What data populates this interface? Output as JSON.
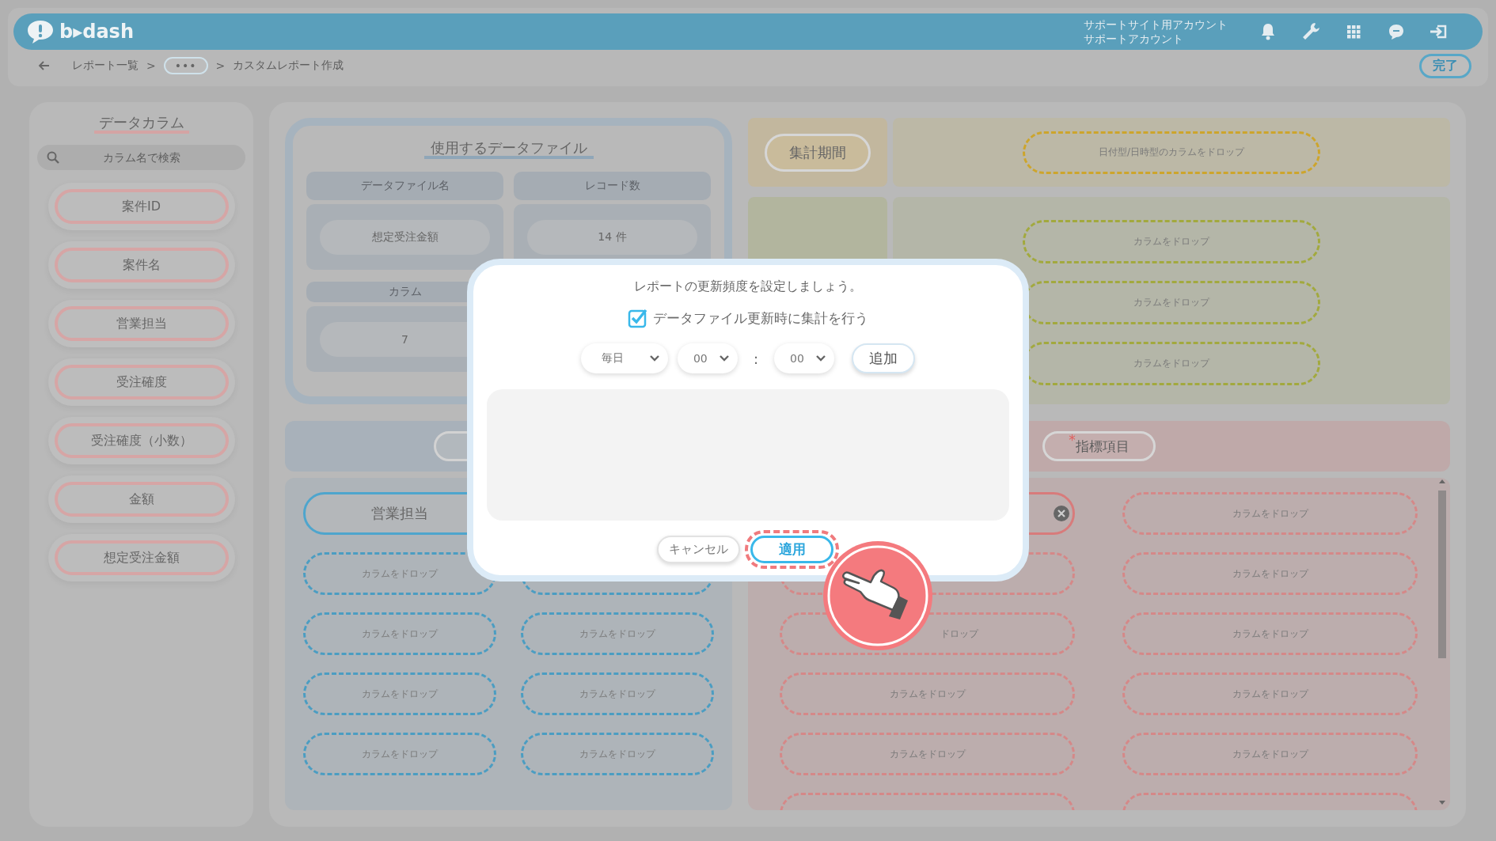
{
  "header": {
    "logo": "b▸dash",
    "account_lines": [
      "サポートサイト用アカウント",
      "サポートアカウント"
    ]
  },
  "breadcrumb": {
    "items": [
      {
        "kind": "link",
        "text": "レポート一覧"
      },
      {
        "kind": "more",
        "text": "•••"
      },
      {
        "kind": "current",
        "text": "カスタムレポート作成"
      }
    ],
    "separator": ">"
  },
  "done_button": "完了",
  "sidebar": {
    "title": "データカラム",
    "search_placeholder": "カラム名で検索",
    "columns": [
      "案件ID",
      "案件名",
      "営業担当",
      "受注確度",
      "受注確度（小数）",
      "金額",
      "想定受注金額"
    ]
  },
  "data_file": {
    "title": "使用するデータファイル",
    "headers": [
      "データファイル名",
      "レコード数"
    ],
    "values": [
      "想定受注金額",
      "14 件"
    ],
    "column_header": "カラム",
    "column_value": "7"
  },
  "period": {
    "label": "集計期間",
    "drop": "日付型/日時型のカラムをドロップ"
  },
  "axis_drops": [
    "カラムをドロップ",
    "カラムをドロップ",
    "カラムをドロップ"
  ],
  "dimensions": {
    "columns": [
      [
        {
          "kind": "filled",
          "text": "営業担当"
        },
        {
          "kind": "drop",
          "text": "カラムをドロップ"
        },
        {
          "kind": "drop",
          "text": "カラムをドロップ"
        },
        {
          "kind": "drop",
          "text": "カラムをドロップ"
        },
        {
          "kind": "drop",
          "text": "カラムをドロップ"
        }
      ],
      [
        {
          "kind": "covered"
        },
        {
          "kind": "drop"
        },
        {
          "kind": "drop",
          "text": "カラムをドロップ"
        },
        {
          "kind": "drop",
          "text": "カラムをドロップ"
        },
        {
          "kind": "drop",
          "text": "カラムをドロップ"
        }
      ]
    ]
  },
  "metrics": {
    "required_mark": "*",
    "label": "指標項目",
    "columns": [
      [
        {
          "kind": "removable"
        },
        {
          "kind": "drop"
        },
        {
          "kind": "drop-tail",
          "text": "ドロップ"
        },
        {
          "kind": "drop",
          "text": "カラムをドロップ"
        },
        {
          "kind": "drop",
          "text": "カラムをドロップ"
        },
        {
          "kind": "drop"
        }
      ],
      [
        {
          "kind": "drop",
          "text": "カラムをドロップ"
        },
        {
          "kind": "drop",
          "text": "カラムをドロップ"
        },
        {
          "kind": "drop",
          "text": "カラムをドロップ"
        },
        {
          "kind": "drop",
          "text": "カラムをドロップ"
        },
        {
          "kind": "drop",
          "text": "カラムをドロップ"
        },
        {
          "kind": "drop"
        }
      ]
    ]
  },
  "modal": {
    "message": "レポートの更新頻度を設定しましょう。",
    "checkbox": {
      "label": "データファイル更新時に集計を行う",
      "checked": true
    },
    "frequency": "毎日",
    "hour": "00",
    "time_separator": ":",
    "minute": "00",
    "add_button": "追加",
    "cancel_button": "キャンセル",
    "apply_button": "適用",
    "apply_highlighted": true
  }
}
